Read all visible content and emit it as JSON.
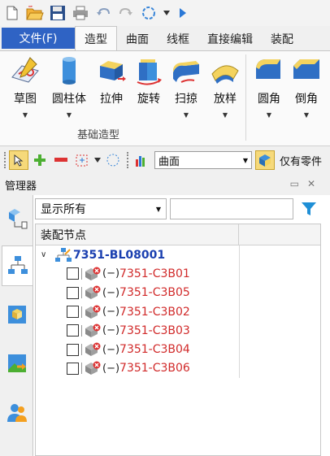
{
  "quick_access": {
    "items": [
      "new-file-icon",
      "open-folder-icon",
      "save-icon",
      "print-icon",
      "undo-icon",
      "redo-icon",
      "select-mode-icon",
      "dropdown-icon",
      "run-icon"
    ]
  },
  "tabs": {
    "file": "文件(F)",
    "items": [
      "造型",
      "曲面",
      "线框",
      "直接编辑",
      "装配"
    ],
    "active": "造型"
  },
  "ribbon": {
    "buttons": [
      {
        "label": "草图"
      },
      {
        "label": "圆柱体"
      },
      {
        "label": "拉伸"
      },
      {
        "label": "旋转"
      },
      {
        "label": "扫掠"
      },
      {
        "label": "放样"
      },
      {
        "label": "圆角"
      },
      {
        "label": "倒角"
      }
    ],
    "group_label": "基础造型"
  },
  "toolbar2": {
    "combo_value": "曲面",
    "filter_text": "仅有零件"
  },
  "manager": {
    "title": "管理器",
    "show_select": "显示所有",
    "search_value": "",
    "column_header": "装配节点",
    "root": "7351-BL08001",
    "status_prefix": "(−)",
    "children": [
      "7351-C3B01",
      "7351-C3B05",
      "7351-C3B02",
      "7351-C3B03",
      "7351-C3B04",
      "7351-C3B06"
    ]
  },
  "colors": {
    "file_tab": "#2f63c4",
    "root_text": "#1a3fb0",
    "child_text": "#d12a2a"
  }
}
